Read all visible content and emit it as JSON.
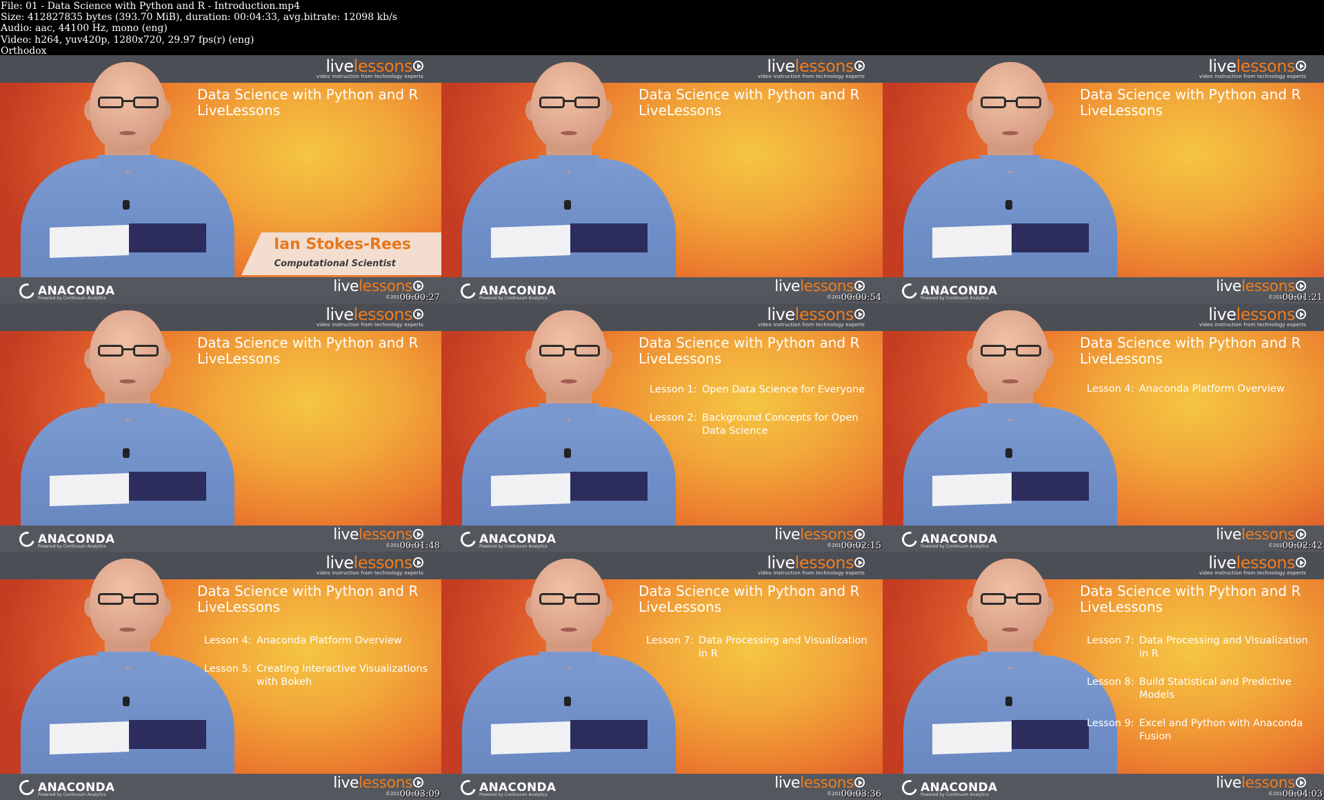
{
  "meta": {
    "lines": [
      "File: 01 - Data Science with Python and R - Introduction.mp4",
      "Size: 412827835 bytes (393.70 MiB), duration: 00:04:33, avg.bitrate: 12098 kb/s",
      "Audio: aac, 44100 Hz, mono (eng)",
      "Video: h264, yuv420p, 1280x720, 29.97 fps(r) (eng)",
      "Orthodox"
    ]
  },
  "branding": {
    "ll_live": "live",
    "ll_lessons": "lessons",
    "ll_tagline": "video instruction from technology experts",
    "anaconda": "ANACONDA",
    "anaconda_sub": "Powered by Continuum Analytics",
    "copyright": "©2017 Pearson",
    "accent_orange": "#f07d1e"
  },
  "course_title": "Data Science with Python and R LiveLessons",
  "presenter": {
    "name": "Ian Stokes-Rees",
    "role": "Computational Scientist"
  },
  "frames": [
    {
      "timestamp": "00:00:27",
      "show_title": true,
      "lower_third": true,
      "lessons": []
    },
    {
      "timestamp": "00:00:54",
      "show_title": true,
      "lower_third": false,
      "lessons": []
    },
    {
      "timestamp": "00:01:21",
      "show_title": true,
      "lower_third": false,
      "lessons": []
    },
    {
      "timestamp": "00:01:48",
      "show_title": true,
      "lower_third": false,
      "lessons": []
    },
    {
      "timestamp": "00:02:15",
      "show_title": true,
      "lower_third": false,
      "lessons": [
        {
          "num": "Lesson 1:",
          "name": "Open Data Science for Everyone"
        },
        {
          "num": "Lesson 2:",
          "name": "Background Concepts for Open Data Science"
        }
      ]
    },
    {
      "timestamp": "00:02:42",
      "show_title": true,
      "lower_third": false,
      "lessons": [
        {
          "num": "Lesson 4:",
          "name": "Anaconda Platform Overview"
        }
      ]
    },
    {
      "timestamp": "00:03:09",
      "show_title": true,
      "lower_third": false,
      "lessons": [
        {
          "num": "Lesson 4:",
          "name": "Anaconda Platform Overview"
        },
        {
          "num": "Lesson 5:",
          "name": "Creating Interactive Visualizations with Bokeh"
        }
      ]
    },
    {
      "timestamp": "00:03:36",
      "show_title": true,
      "lower_third": false,
      "lessons": [
        {
          "num": "Lesson 7:",
          "name": "Data Processing and Visualization in R"
        }
      ]
    },
    {
      "timestamp": "00:04:03",
      "show_title": true,
      "lower_third": false,
      "lessons": [
        {
          "num": "Lesson 7:",
          "name": "Data Processing and Visualization in R"
        },
        {
          "num": "Lesson 8:",
          "name": "Build Statistical and Predictive Models"
        },
        {
          "num": "Lesson 9:",
          "name": "Excel and Python with Anaconda Fusion"
        }
      ]
    }
  ]
}
